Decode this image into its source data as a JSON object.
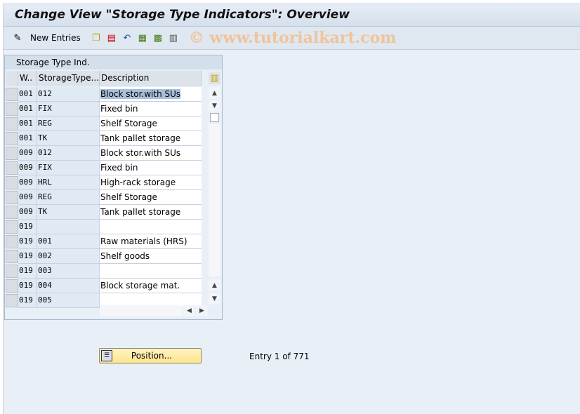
{
  "title": "Change View \"Storage Type Indicators\": Overview",
  "toolbar": {
    "new_entries": "New Entries",
    "watermark": "© www.tutorialkart.com"
  },
  "table": {
    "title": "Storage Type Ind.",
    "columns": [
      "W..",
      "StorageType...",
      "Description"
    ],
    "rows": [
      [
        "001",
        "012",
        "Block stor.with SUs"
      ],
      [
        "001",
        "FIX",
        "Fixed bin"
      ],
      [
        "001",
        "REG",
        "Shelf Storage"
      ],
      [
        "001",
        "TK",
        "Tank pallet storage"
      ],
      [
        "009",
        "012",
        "Block stor.with SUs"
      ],
      [
        "009",
        "FIX",
        "Fixed bin"
      ],
      [
        "009",
        "HRL",
        "High-rack storage"
      ],
      [
        "009",
        "REG",
        "Shelf Storage"
      ],
      [
        "009",
        "TK",
        "Tank pallet storage"
      ],
      [
        "019",
        "",
        ""
      ],
      [
        "019",
        "001",
        "Raw materials (HRS)"
      ],
      [
        "019",
        "002",
        "Shelf goods"
      ],
      [
        "019",
        "003",
        ""
      ],
      [
        "019",
        "004",
        "Block storage mat."
      ],
      [
        "019",
        "005",
        ""
      ]
    ]
  },
  "position_button": "Position...",
  "entry_info": "Entry 1 of 771"
}
